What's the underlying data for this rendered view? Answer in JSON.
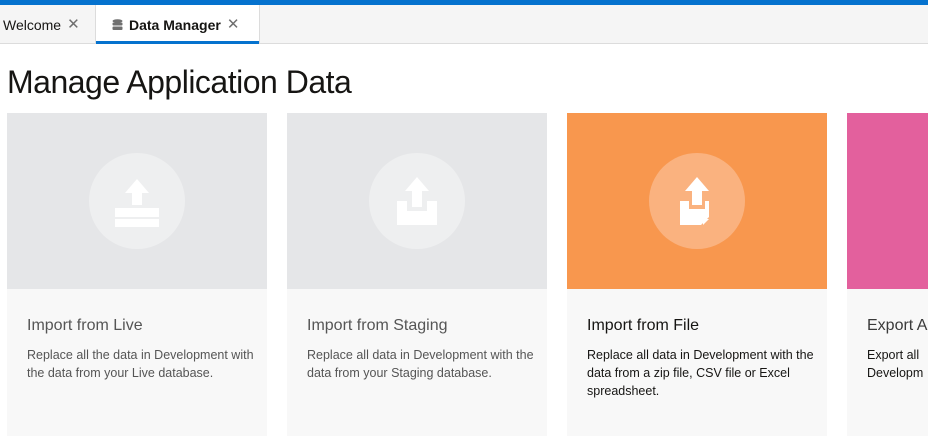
{
  "tabs": [
    {
      "label": "Welcome",
      "close": "✕"
    },
    {
      "label": "Data Manager",
      "close": "✕",
      "icon": "database-icon"
    }
  ],
  "page": {
    "title": "Manage Application Data"
  },
  "cards": [
    {
      "title": "Import from Live",
      "description": "Replace all the data in Development with the data from your Live database.",
      "color": "#e5e6e8",
      "icon": "upload-tray-icon"
    },
    {
      "title": "Import from Staging",
      "description": "Replace all data in Development with the data from your Staging database.",
      "color": "#e5e6e8",
      "icon": "upload-box-icon"
    },
    {
      "title": "Import from File",
      "description": "Replace all data in Development with the data from a zip file, CSV file or Excel spreadsheet.",
      "color": "#f8974e",
      "icon": "upload-file-icon"
    },
    {
      "title": "Export A",
      "description": "Export all",
      "description2": "Developm",
      "color": "#e3609d"
    }
  ],
  "colors": {
    "accent": "#0572ce"
  }
}
